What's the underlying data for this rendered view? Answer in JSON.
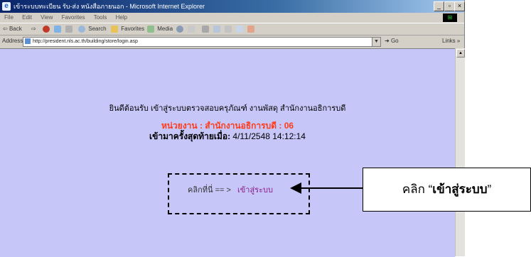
{
  "window": {
    "title": "เข้าระบบทะเบียน รับ-ส่ง หนังสือภายนอก - Microsoft Internet Explorer",
    "buttons": [
      "_",
      "▫",
      "×"
    ]
  },
  "menubar": [
    "File",
    "Edit",
    "View",
    "Favorites",
    "Tools",
    "Help"
  ],
  "toolbar": {
    "back": "Back",
    "search": "Search",
    "favorites": "Favorites",
    "media": "Media"
  },
  "address": {
    "label": "Address",
    "url": "http://president.nls.ac.th/building/store/login.asp",
    "go": "Go",
    "links": "Links"
  },
  "page": {
    "welcome": "ยินดีต้อนรับ เข้าสู่ระบบตรวจสอบครุภัณฑ์ งานพัสดุ สำนักงานอธิการบดี",
    "unit_label": "หน่วยงาน : สำนักงานอธิการบดี",
    "unit_code": ": 06",
    "last_login_label": "เข้ามาครั้งสุดท้ายเมื่อ:",
    "last_login_value": "4/11/2548 14:12:14",
    "click_prompt": "คลิกที่นี่ == >",
    "enter_link": "เข้าสู่ระบบ"
  },
  "callout": {
    "prefix": "คลิก “",
    "bold": "เข้าสู่ระบบ",
    "suffix": "”"
  },
  "colors": {
    "content_bg": "#c6c6f8",
    "unit_text": "#ff3b1a",
    "link_text": "#8a1c8a"
  }
}
